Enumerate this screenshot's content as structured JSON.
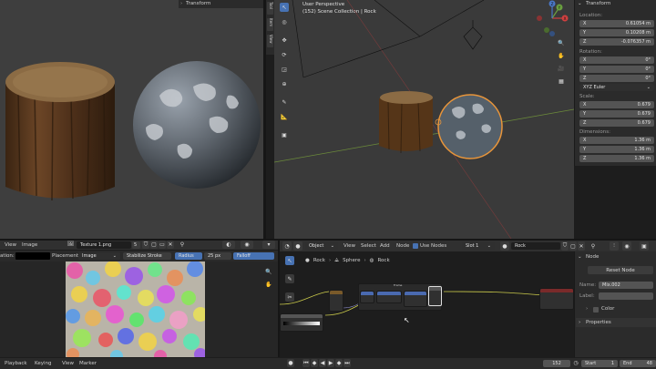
{
  "viewport_left": {
    "header_label": "Transform"
  },
  "side_tabs": [
    "Tool",
    "Item",
    "View"
  ],
  "viewport3d": {
    "view_name": "User Perspective",
    "collection": "(152) Scene Collection | Rock"
  },
  "nav_gizmo": {
    "x": "X",
    "y": "Y",
    "z": "Z"
  },
  "properties": {
    "title": "Transform",
    "location_label": "Location:",
    "location": [
      {
        "axis": "X",
        "value": "0.61054 m"
      },
      {
        "axis": "Y",
        "value": "0.10208 m"
      },
      {
        "axis": "Z",
        "value": "-0.076357 m"
      }
    ],
    "rotation_label": "Rotation:",
    "rotation": [
      {
        "axis": "X",
        "value": "0°"
      },
      {
        "axis": "Y",
        "value": "0°"
      },
      {
        "axis": "Z",
        "value": "0°"
      }
    ],
    "rotation_mode": "XYZ Euler",
    "scale_label": "Scale:",
    "scale": [
      {
        "axis": "X",
        "value": "0.679"
      },
      {
        "axis": "Y",
        "value": "0.679"
      },
      {
        "axis": "Z",
        "value": "0.679"
      }
    ],
    "dimensions_label": "Dimensions:",
    "dimensions": [
      {
        "axis": "X",
        "value": "1.36 m"
      },
      {
        "axis": "Y",
        "value": "1.36 m"
      },
      {
        "axis": "Z",
        "value": "1.36 m"
      }
    ]
  },
  "image_editor": {
    "menu": [
      "View",
      "Image"
    ],
    "image_name": "Texture 1.png",
    "users": "5",
    "color_label": "ation:",
    "placement_label": "Placement",
    "placement_value": "Image",
    "stabilize": "Stabilize Stroke",
    "radius": "Radius",
    "px_value": "25 px",
    "falloff": "Falloff"
  },
  "node_editor": {
    "object_mode": "Object",
    "menu": [
      "View",
      "Select",
      "Add",
      "Node"
    ],
    "use_nodes": "Use Nodes",
    "slot": "Slot 1",
    "material": "Rock",
    "breadcrumb": [
      "Rock",
      "Sphere",
      "Rock"
    ],
    "frame_label": "Frame"
  },
  "node_panel": {
    "title": "Node",
    "reset": "Reset Node",
    "name_label": "Name:",
    "name_value": "Mix.002",
    "label_label": "Label:",
    "color_label": "Color",
    "properties_label": "Properties"
  },
  "timeline": {
    "menu": [
      "Playback",
      "Keying",
      "View",
      "Marker"
    ],
    "current_frame": "152",
    "start_label": "Start",
    "start_value": "1",
    "end_label": "End",
    "end_value": "48"
  },
  "colors": {
    "accent": "#4772b3",
    "selection": "#e8953a",
    "bg": "#1d1d1d",
    "panel": "#303030"
  }
}
